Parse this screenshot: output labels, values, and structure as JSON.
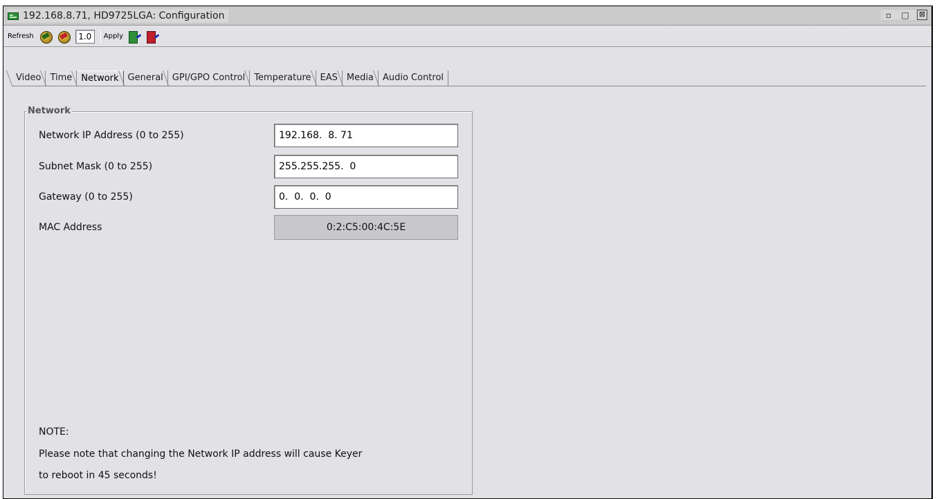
{
  "window": {
    "title": "192.168.8.71, HD9725LGA: Configuration",
    "controls": {
      "restore": "▫",
      "maximize": "□",
      "close": "⊠"
    }
  },
  "toolbar": {
    "refresh_label": "Refresh",
    "rate_value": "1.0",
    "apply_label": "Apply"
  },
  "tabs": [
    {
      "label": "Video"
    },
    {
      "label": "Time"
    },
    {
      "label": "Network",
      "active": true
    },
    {
      "label": "General"
    },
    {
      "label": "GPI/GPO Control"
    },
    {
      "label": "Temperature"
    },
    {
      "label": "EAS"
    },
    {
      "label": "Media"
    },
    {
      "label": "Audio Control"
    }
  ],
  "network": {
    "legend": "Network",
    "ip_label": "Network IP Address (0 to 255)",
    "ip_value": "192.168.  8. 71",
    "subnet_label": "Subnet Mask (0 to 255)",
    "subnet_value": "255.255.255.  0",
    "gateway_label": "Gateway (0 to 255)",
    "gateway_value": "0.  0.  0.  0",
    "mac_label": "MAC Address",
    "mac_value": "0:2:C5:00:4C:5E",
    "note_title": "NOTE:",
    "note_line1": "Please note that changing the Network IP address will cause Keyer",
    "note_line2": "to reboot in 45 seconds!"
  },
  "colors": {
    "panel_bg": "#e1e1e6",
    "readonly_bg": "#c7c7cc"
  }
}
